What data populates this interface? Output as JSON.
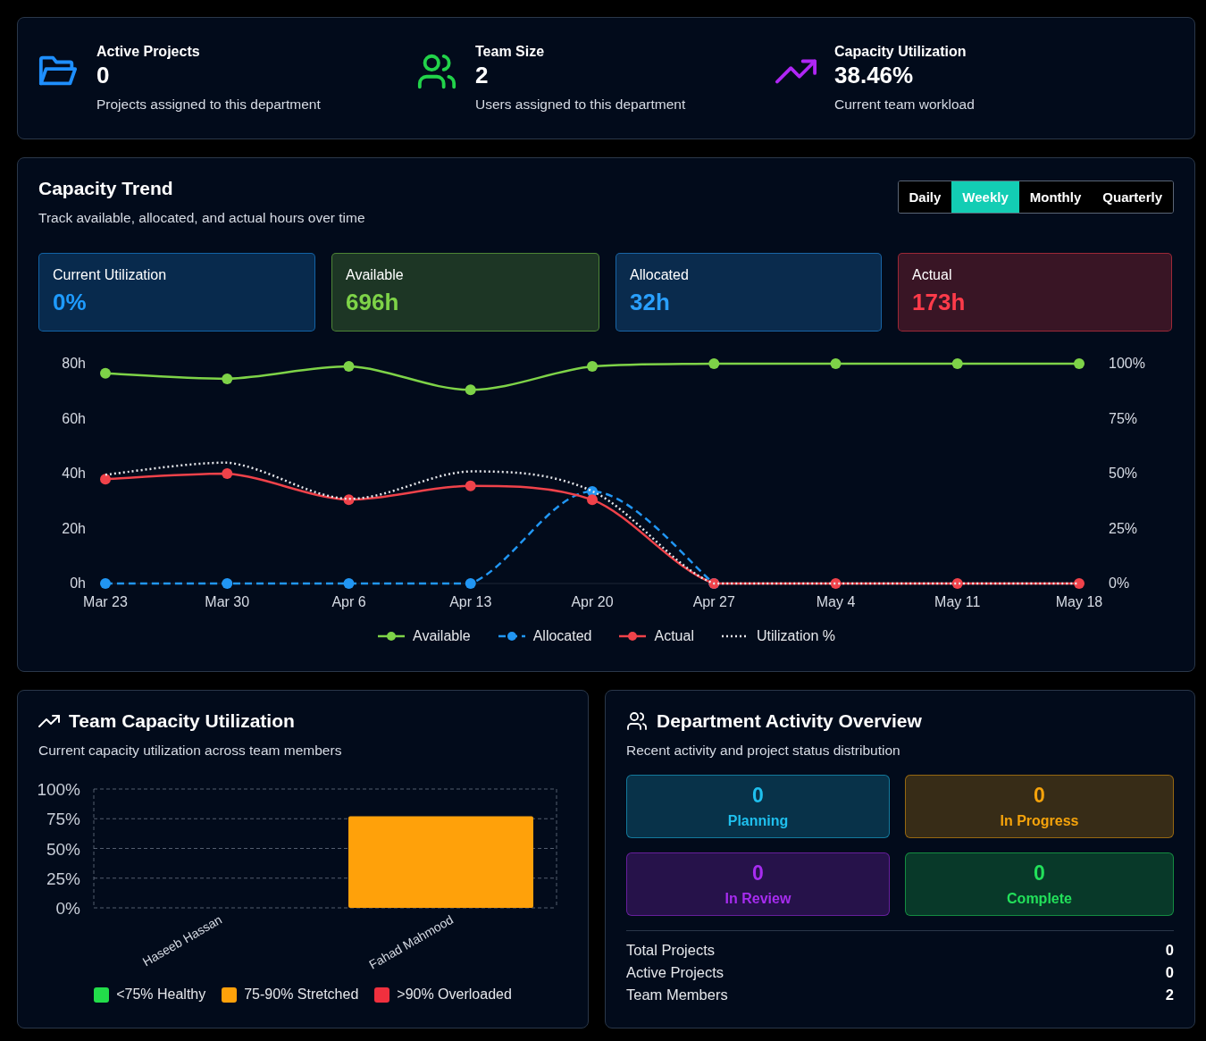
{
  "stats": [
    {
      "kind": "folder",
      "color": "#1e8fff",
      "label": "Active Projects",
      "value": "0",
      "caption": "Projects assigned to this department"
    },
    {
      "kind": "users",
      "color": "#22d34a",
      "label": "Team Size",
      "value": "2",
      "caption": "Users assigned to this department"
    },
    {
      "kind": "trend",
      "color": "#b026f5",
      "label": "Capacity Utilization",
      "value": "38.46%",
      "caption": "Current team workload"
    }
  ],
  "trend": {
    "title": "Capacity Trend",
    "subtitle": "Track available, allocated, and actual hours over time",
    "periods": [
      {
        "label": "Daily",
        "selected": false
      },
      {
        "label": "Weekly",
        "selected": true
      },
      {
        "label": "Monthly",
        "selected": false
      },
      {
        "label": "Quarterly",
        "selected": false
      }
    ],
    "metrics": [
      {
        "label": "Current Utilization",
        "value": "0%",
        "color": "#1e9bff"
      },
      {
        "label": "Available",
        "value": "696h",
        "color": "#7ed348"
      },
      {
        "label": "Allocated",
        "value": "32h",
        "color": "#2aa0ff"
      },
      {
        "label": "Actual",
        "value": "173h",
        "color": "#ff3b4a"
      }
    ],
    "chart_data": {
      "type": "line",
      "categories": [
        "Mar 23",
        "Mar 30",
        "Apr 6",
        "Apr 13",
        "Apr 20",
        "Apr 27",
        "May 4",
        "May 11",
        "May 18"
      ],
      "ylim": [
        0,
        80
      ],
      "yticks": [
        {
          "value": 0,
          "label": "0h"
        },
        {
          "value": 20,
          "label": "20h"
        },
        {
          "value": 40,
          "label": "40h"
        },
        {
          "value": 60,
          "label": "60h"
        },
        {
          "value": 80,
          "label": "80h"
        }
      ],
      "y2lim": [
        0,
        100
      ],
      "y2ticks": [
        {
          "value": 0,
          "label": "0%"
        },
        {
          "value": 25,
          "label": "25%"
        },
        {
          "value": 50,
          "label": "50%"
        },
        {
          "value": 75,
          "label": "75%"
        },
        {
          "value": 100,
          "label": "100%"
        }
      ],
      "series": [
        {
          "name": "Available",
          "color": "#7ed348",
          "line_style": "solid",
          "marker": "circle",
          "values": [
            76.5,
            74.5,
            79,
            70.5,
            79,
            80,
            80,
            80,
            80
          ]
        },
        {
          "name": "Allocated",
          "color": "#2196f3",
          "line_style": "dashed",
          "marker": "circle",
          "values": [
            0,
            0,
            0,
            0,
            33.5,
            0,
            null,
            null,
            null
          ]
        },
        {
          "name": "Actual",
          "color": "#f0424a",
          "line_style": "solid",
          "marker": "circle",
          "values": [
            38,
            40,
            30.5,
            35.5,
            30.5,
            0,
            0,
            0,
            0
          ]
        },
        {
          "name": "Utilization %",
          "color": "#e5e7eb",
          "line_style": "dotted",
          "marker": "none",
          "axis": "y2",
          "values": [
            49.5,
            55,
            38.5,
            51,
            42,
            0,
            0,
            0,
            0
          ]
        }
      ],
      "legend": true
    }
  },
  "team_utilization": {
    "title": "Team Capacity Utilization",
    "subtitle": "Current capacity utilization across team members",
    "chart_data": {
      "type": "bar",
      "categories": [
        "Haseeb Hassan",
        "Fahad Mahmood"
      ],
      "series": [
        {
          "color": "#ffa10a",
          "values": [
            0,
            77
          ]
        }
      ],
      "ylim": [
        0,
        100
      ],
      "grid": true,
      "yticks": [
        {
          "value": 0,
          "label": "0%"
        },
        {
          "value": 25,
          "label": "25%"
        },
        {
          "value": 50,
          "label": "50%"
        },
        {
          "value": 75,
          "label": "75%"
        },
        {
          "value": 100,
          "label": "100%"
        }
      ]
    },
    "legend": [
      {
        "label": "<75% Healthy",
        "color": "#22dd4a"
      },
      {
        "label": "75-90% Stretched",
        "color": "#ffa10a"
      },
      {
        "label": ">90% Overloaded",
        "color": "#f0303e"
      }
    ]
  },
  "activity": {
    "title": "Department Activity Overview",
    "subtitle": "Recent activity and project status distribution",
    "statuses": [
      {
        "count": "0",
        "label": "Planning",
        "color": "#1fc0ee"
      },
      {
        "count": "0",
        "label": "In Progress",
        "color": "#f5a30b"
      },
      {
        "count": "0",
        "label": "In Review",
        "color": "#a72cf0"
      },
      {
        "count": "0",
        "label": "Complete",
        "color": "#22e05a"
      }
    ],
    "summary": [
      {
        "label": "Total Projects",
        "value": "0"
      },
      {
        "label": "Active Projects",
        "value": "0"
      },
      {
        "label": "Team Members",
        "value": "2"
      }
    ]
  }
}
